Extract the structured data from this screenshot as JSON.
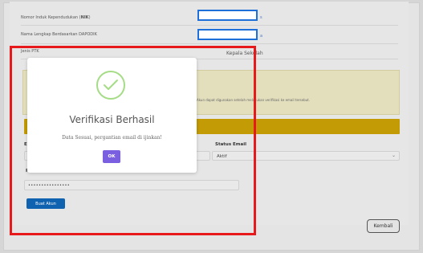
{
  "form": {
    "nik_label_prefix": "Nomor Induk Kependudukan (",
    "nik_label_bold": "NIK",
    "nik_label_suffix": ")",
    "nama_label": "Nama Lengkap Berdasarkan DAPODIK",
    "jenis_ptk_label": "Jenis PTK",
    "jenis_ptk_value": "Kepala Sekolah",
    "nik_marker": "s",
    "nama_marker": "a",
    "email_label_fragment": "E",
    "password_label_fragment": "P",
    "status_email_label": "Status Email",
    "status_email_value": "Aktif",
    "password_label": "Password",
    "password_value": "••••••••••••••••"
  },
  "info": {
    "text": "Akun dapat digunakan setelah melakukan verifikasi ke email tersebut."
  },
  "actions": {
    "buat_akun_label": "Buat Akun",
    "kembali_label": "Kembali"
  },
  "modal": {
    "title": "Verifikasi Berhasil",
    "message": "Data Sesuai, pergantian email di ijinkan!",
    "ok_label": "OK"
  },
  "colors": {
    "highlight_frame": "#e8191b",
    "input_highlight": "#1e6fd9",
    "success_icon": "#a5dc86",
    "ok_button": "#7a5fe0",
    "buat_akun_button": "#0f62b0",
    "warning_bar": "#c39b05"
  },
  "icons": {
    "success": "checkmark-circle-icon",
    "select": "chevron-down-icon"
  }
}
